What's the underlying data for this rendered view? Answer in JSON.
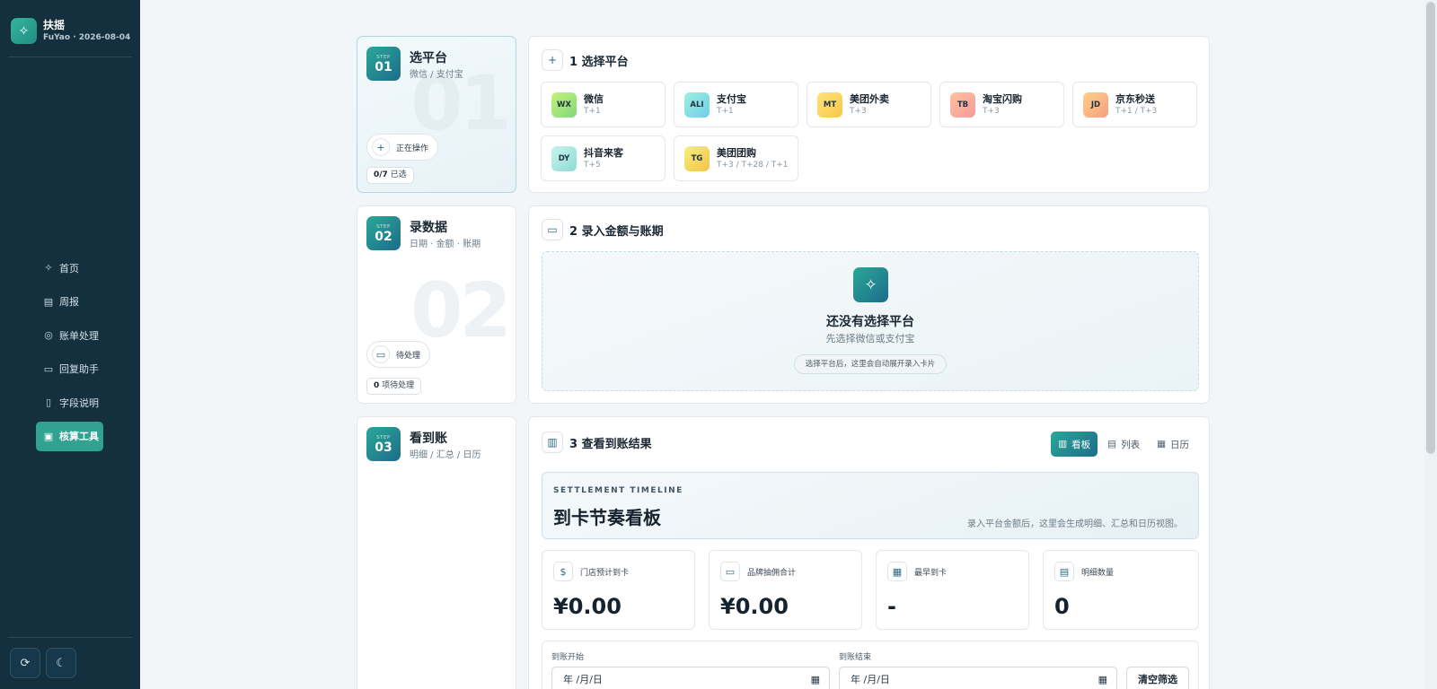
{
  "app": {
    "name": "扶摇",
    "subtitle": "FuYao · 2026-08-04"
  },
  "nav": [
    {
      "label": "首页",
      "icon": "sparkle-icon"
    },
    {
      "label": "周报",
      "icon": "document-icon"
    },
    {
      "label": "账单处理",
      "icon": "database-icon"
    },
    {
      "label": "回复助手",
      "icon": "chat-icon"
    },
    {
      "label": "字段说明",
      "icon": "book-icon"
    },
    {
      "label": "核算工具",
      "icon": "calculator-icon",
      "active": true
    }
  ],
  "steps": [
    {
      "kicker": "STEP",
      "num": "01",
      "title": "选平台",
      "sub": "微信 / 支付宝",
      "ghost": "01",
      "pill": "正在操作",
      "count_num": "0/7",
      "count_text": "已选"
    },
    {
      "kicker": "STEP",
      "num": "02",
      "title": "录数据",
      "sub": "日期 · 金额 · 账期",
      "ghost": "02",
      "pill": "待处理",
      "count_num": "0",
      "count_text": "项待处理"
    },
    {
      "kicker": "STEP",
      "num": "03",
      "title": "看到账",
      "sub": "明细 / 汇总 / 日历"
    }
  ],
  "platforms_section": {
    "title": "1 选择平台",
    "items": [
      {
        "code": "WX",
        "name": "微信",
        "tag": "T+1",
        "color": "linear-gradient(135deg,#c6f27c,#7fd87a)"
      },
      {
        "code": "ALI",
        "name": "支付宝",
        "tag": "T+1",
        "color": "linear-gradient(135deg,#9ef0e0,#6fcde8)"
      },
      {
        "code": "MT",
        "name": "美团外卖",
        "tag": "T+3",
        "color": "linear-gradient(135deg,#ffe27a,#f7c84a)"
      },
      {
        "code": "TB",
        "name": "淘宝闪购",
        "tag": "T+3",
        "color": "linear-gradient(135deg,#ffc2a0,#f79a9a)"
      },
      {
        "code": "JD",
        "name": "京东秒送",
        "tag": "T+1 / T+3",
        "color": "linear-gradient(135deg,#ffd08a,#f79e7e)"
      },
      {
        "code": "DY",
        "name": "抖音来客",
        "tag": "T+5",
        "color": "linear-gradient(135deg,#c6f5ea,#8fdad8)"
      },
      {
        "code": "TG",
        "name": "美团团购",
        "tag": "T+3 / T+28 / T+1",
        "color": "linear-gradient(135deg,#f5f07a,#f4c34a)"
      }
    ]
  },
  "entry_section": {
    "title": "2 录入金额与账期",
    "empty_title": "还没有选择平台",
    "empty_sub": "先选择微信或支付宝",
    "empty_note": "选择平台后，这里会自动展开录入卡片"
  },
  "result_section": {
    "title": "3 查看到账结果",
    "tabs": [
      {
        "label": "看板",
        "active": true
      },
      {
        "label": "列表"
      },
      {
        "label": "日历"
      }
    ],
    "hero_kicker": "SETTLEMENT TIMELINE",
    "hero_title": "到卡节奏看板",
    "hero_desc": "录入平台金额后，这里会生成明细、汇总和日历视图。",
    "stats": [
      {
        "label": "门店预计到卡",
        "value": "¥0.00",
        "icon": "dollar-icon"
      },
      {
        "label": "品牌抽佣合计",
        "value": "¥0.00",
        "icon": "card-icon"
      },
      {
        "label": "最早到卡",
        "value": "-",
        "icon": "calendar-icon"
      },
      {
        "label": "明细数量",
        "value": "0",
        "icon": "clipboard-icon"
      }
    ],
    "filter": {
      "start_label": "到账开始",
      "end_label": "到账结束",
      "start_value": "年 /月/日",
      "end_value": "年 /月/日",
      "clear_label": "清空筛选"
    }
  }
}
